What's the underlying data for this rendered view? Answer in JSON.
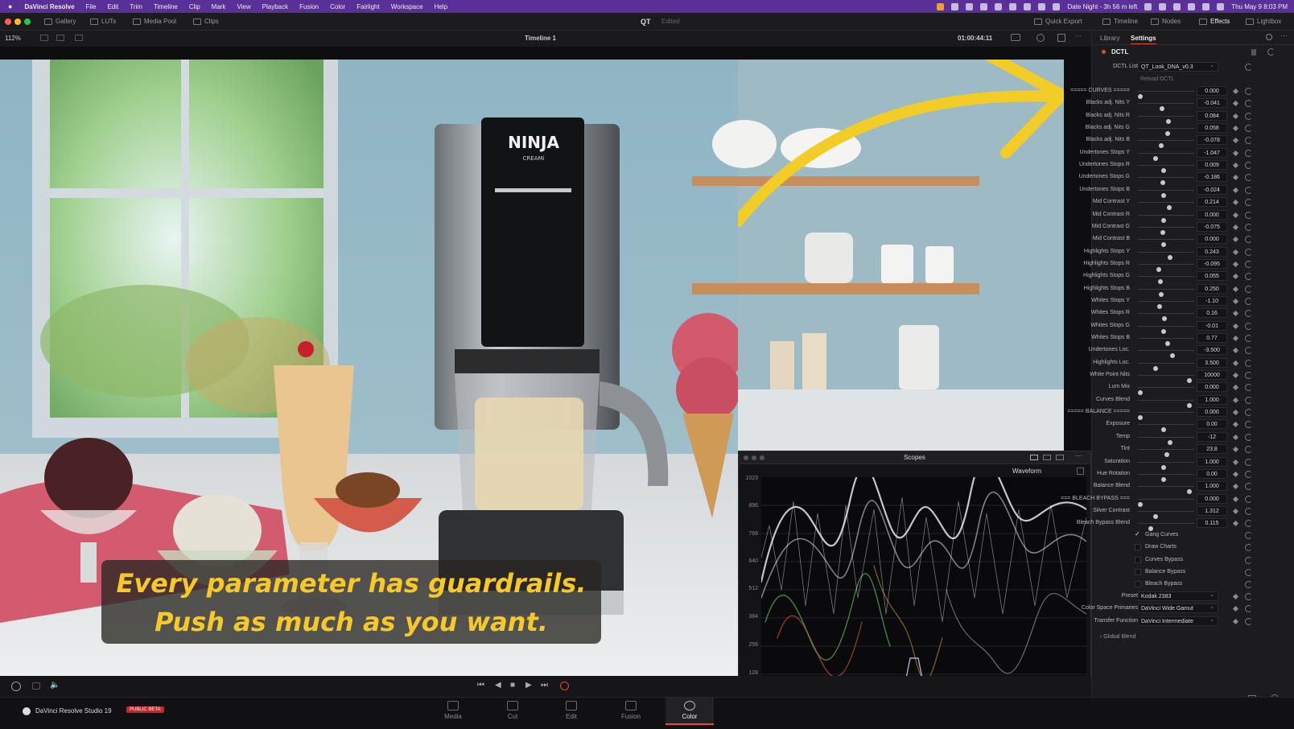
{
  "menubar": {
    "app": "DaVinci Resolve",
    "items": [
      "File",
      "Edit",
      "Trim",
      "Timeline",
      "Clip",
      "Mark",
      "View",
      "Playback",
      "Fusion",
      "Color",
      "Fairlight",
      "Workspace",
      "Help"
    ],
    "battery": "Date Night - 3h 56 m left",
    "clock": "Thu May 9  8:03 PM"
  },
  "toolbar": {
    "left": [
      "Gallery",
      "LUTs",
      "Media Pool",
      "Clips"
    ],
    "project": "QT",
    "edited": "Edited",
    "right": [
      "Quick Export",
      "Timeline",
      "Nodes",
      "Effects",
      "Lightbox"
    ]
  },
  "viewer": {
    "zoom": "112%",
    "timeline": "Timeline 1",
    "timecode": "01:00:44:11"
  },
  "panel": {
    "tabs": [
      "Library",
      "Settings"
    ],
    "section": "DCTL",
    "dctl_list_label": "DCTL List",
    "dctl_list_value": "QT_Look_DNA_v0.3",
    "reload": "Reload DCTL"
  },
  "params": [
    {
      "label": "===== CURVES =====",
      "value": "0.000",
      "pos": 0.0
    },
    {
      "label": "Blacks adj. Nits Y",
      "value": "-0.041",
      "pos": 0.42
    },
    {
      "label": "Blacks adj. Nits R",
      "value": "0.084",
      "pos": 0.55
    },
    {
      "label": "Blacks adj. Nits G",
      "value": "0.058",
      "pos": 0.53
    },
    {
      "label": "Blacks adj. Nits B",
      "value": "-0.078",
      "pos": 0.4
    },
    {
      "label": "Undertones Stops Y",
      "value": "-1.047",
      "pos": 0.3
    },
    {
      "label": "Undertones Stops R",
      "value": "0.009",
      "pos": 0.46
    },
    {
      "label": "Undertones Stops G",
      "value": "-0.186",
      "pos": 0.44
    },
    {
      "label": "Undertones Stops B",
      "value": "-0.024",
      "pos": 0.46
    },
    {
      "label": "Mid Contrast Y",
      "value": "0.214",
      "pos": 0.57
    },
    {
      "label": "Mid Contrast R",
      "value": "0.000",
      "pos": 0.46
    },
    {
      "label": "Mid Contrast G",
      "value": "-0.075",
      "pos": 0.43
    },
    {
      "label": "Mid Contrast B",
      "value": "0.000",
      "pos": 0.46
    },
    {
      "label": "Highlights Stops Y",
      "value": "0.243",
      "pos": 0.58
    },
    {
      "label": "Highlights Stops R",
      "value": "-0.095",
      "pos": 0.36
    },
    {
      "label": "Highlights Stops G",
      "value": "0.055",
      "pos": 0.39
    },
    {
      "label": "Highlights Stops B",
      "value": "0.250",
      "pos": 0.4
    },
    {
      "label": "Whites Stops Y",
      "value": "-1.10",
      "pos": 0.38
    },
    {
      "label": "Whites Stops R",
      "value": "0.16",
      "pos": 0.47
    },
    {
      "label": "Whites Stops G",
      "value": "-0.01",
      "pos": 0.46
    },
    {
      "label": "Whites Stops B",
      "value": "0.77",
      "pos": 0.53
    },
    {
      "label": "Undertones Loc.",
      "value": "-3.500",
      "pos": 0.62
    },
    {
      "label": "Highlights Loc.",
      "value": "3.500",
      "pos": 0.3
    },
    {
      "label": "White Point Nits",
      "value": "10000",
      "pos": 0.95
    },
    {
      "label": "Lum Mix",
      "value": "0.000",
      "pos": 0.0
    },
    {
      "label": "Curves Blend",
      "value": "1.000",
      "pos": 0.95
    },
    {
      "label": "===== BALANCE =====",
      "value": "0.000",
      "pos": 0.0
    },
    {
      "label": "Exposure",
      "value": "0.00",
      "pos": 0.46
    },
    {
      "label": "Temp",
      "value": "-12",
      "pos": 0.58
    },
    {
      "label": "Tint",
      "value": "23.8",
      "pos": 0.52
    },
    {
      "label": "Saturation",
      "value": "1.000",
      "pos": 0.46
    },
    {
      "label": "Hue Rotation",
      "value": "0.00",
      "pos": 0.46
    },
    {
      "label": "Balance Blend",
      "value": "1.000",
      "pos": 0.95
    },
    {
      "label": "=== BLEACH BYPASS ===",
      "value": "0.000",
      "pos": 0.0
    },
    {
      "label": "Silver Contrast",
      "value": "1.312",
      "pos": 0.3
    },
    {
      "label": "Bleach Bypass Blend",
      "value": "0.115",
      "pos": 0.2
    }
  ],
  "checkboxes": [
    {
      "label": "Gang Curves",
      "checked": true
    },
    {
      "label": "Draw Charts",
      "checked": false
    },
    {
      "label": "Curves Bypass",
      "checked": false
    },
    {
      "label": "Balance Bypass",
      "checked": false
    },
    {
      "label": "Bleach Bypass",
      "checked": false
    }
  ],
  "dropdowns": [
    {
      "label": "Preset",
      "value": "Kodak 2383"
    },
    {
      "label": "Color Space Primaries",
      "value": "DaVinci Wide Gamut"
    },
    {
      "label": "Transfer Function",
      "value": "DaVinci Intermediate"
    }
  ],
  "global_blend": "Global Blend",
  "scopes": {
    "title": "Scopes",
    "mode": "Waveform",
    "ticks": [
      "1023",
      "896",
      "768",
      "640",
      "512",
      "384",
      "256",
      "128",
      "0"
    ]
  },
  "subtitle": {
    "line1": "Every parameter has guardrails.",
    "line2": "Push as much as you want."
  },
  "product": {
    "brand": "NINJA",
    "model": "CREAMi"
  },
  "footer": {
    "app": "DaVinci Resolve Studio 19",
    "badge": "PUBLIC BETA",
    "pages": [
      "Media",
      "Cut",
      "Edit",
      "Fusion",
      "Color"
    ]
  },
  "colors": {
    "menubar": "#5b2f98",
    "accent": "#f7c82a",
    "active_page": "#e8473c"
  }
}
